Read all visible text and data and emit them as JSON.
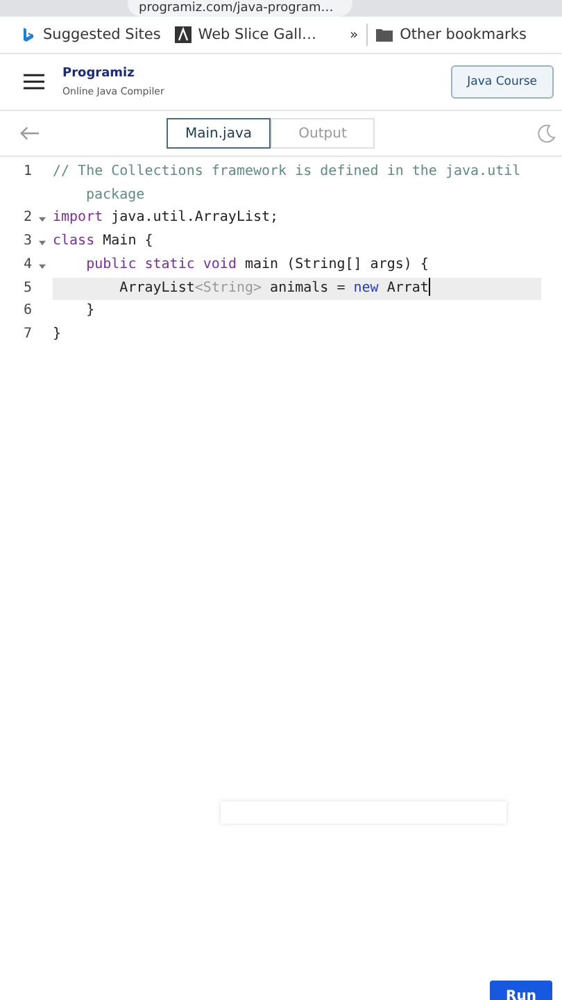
{
  "browser": {
    "url": "programiz.com/java-program…",
    "bookmarks": [
      {
        "label": "Suggested Sites",
        "kind": "bing"
      },
      {
        "label": "Web Slice Gall…",
        "kind": "slice"
      }
    ],
    "overflow": "»",
    "other_bookmarks": "Other bookmarks"
  },
  "header": {
    "logo": "Programiz",
    "subtitle": "Online Java Compiler",
    "course_button": "Java Course"
  },
  "tabs": [
    {
      "label": "Main.java",
      "selected": true
    },
    {
      "label": "Output",
      "selected": false
    }
  ],
  "editor": {
    "lines": [
      {
        "number": "1",
        "fold": false,
        "selected": false,
        "tokens": [
          {
            "kind": "comment",
            "text": "// The Collections framework is defined in the java.util package"
          }
        ]
      },
      {
        "number": "2",
        "fold": true,
        "selected": false,
        "tokens": [
          {
            "kind": "keyword",
            "text": "import"
          },
          {
            "kind": "plain",
            "text": " java.util.ArrayList;"
          }
        ]
      },
      {
        "number": "3",
        "fold": true,
        "selected": false,
        "tokens": [
          {
            "kind": "keyword",
            "text": "class"
          },
          {
            "kind": "plain",
            "text": " Main {"
          }
        ]
      },
      {
        "number": "4",
        "fold": true,
        "selected": false,
        "tokens": [
          {
            "kind": "keyword",
            "text": "    public static void"
          },
          {
            "kind": "plain",
            "text": " main (String[] args) {"
          }
        ]
      },
      {
        "number": "5",
        "fold": false,
        "selected": true,
        "tokens": [
          {
            "kind": "plain",
            "text": "        ArrayList"
          },
          {
            "kind": "generic",
            "text": "<String>"
          },
          {
            "kind": "plain",
            "text": " animals = "
          },
          {
            "kind": "new",
            "text": "new"
          },
          {
            "kind": "plain",
            "text": " Arrat"
          }
        ]
      },
      {
        "number": "6",
        "fold": false,
        "selected": false,
        "tokens": [
          {
            "kind": "plain",
            "text": "    }"
          }
        ]
      },
      {
        "number": "7",
        "fold": false,
        "selected": false,
        "tokens": [
          {
            "kind": "plain",
            "text": "}"
          }
        ]
      }
    ]
  },
  "run_button": "Run"
}
